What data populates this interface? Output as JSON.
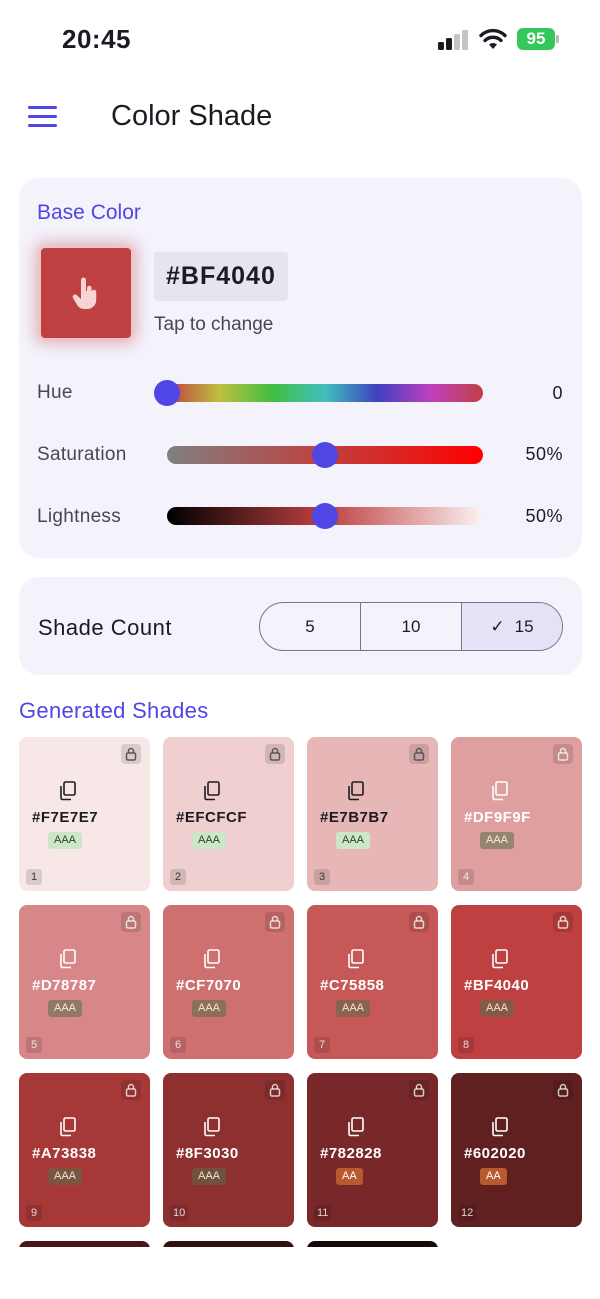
{
  "status_bar": {
    "time": "20:45",
    "battery": "95"
  },
  "app_bar": {
    "title": "Color Shade",
    "menu_icon": "menu-icon"
  },
  "base_color": {
    "section_title": "Base Color",
    "hex": "#BF4040",
    "hint": "Tap to change",
    "swatch_color": "#BF4040",
    "sliders": [
      {
        "label": "Hue",
        "value": "0",
        "fraction": 0.0
      },
      {
        "label": "Saturation",
        "value": "50%",
        "fraction": 0.5
      },
      {
        "label": "Lightness",
        "value": "50%",
        "fraction": 0.5
      }
    ]
  },
  "shade_count": {
    "label": "Shade Count",
    "options": [
      "5",
      "10",
      "15"
    ],
    "selected": "15"
  },
  "generated_shades": {
    "title": "Generated Shades",
    "shades": [
      {
        "index": "1",
        "hex": "#F7E7E7",
        "badge": "AAA"
      },
      {
        "index": "2",
        "hex": "#EFCFCF",
        "badge": "AAA"
      },
      {
        "index": "3",
        "hex": "#E7B7B7",
        "badge": "AAA"
      },
      {
        "index": "4",
        "hex": "#DF9F9F",
        "badge": "AAA"
      },
      {
        "index": "5",
        "hex": "#D78787",
        "badge": "AAA"
      },
      {
        "index": "6",
        "hex": "#CF7070",
        "badge": "AAA"
      },
      {
        "index": "7",
        "hex": "#C75858",
        "badge": "AAA"
      },
      {
        "index": "8",
        "hex": "#BF4040",
        "badge": "AAA"
      },
      {
        "index": "9",
        "hex": "#A73838",
        "badge": "AAA"
      },
      {
        "index": "10",
        "hex": "#8F3030",
        "badge": "AAA"
      },
      {
        "index": "11",
        "hex": "#782828",
        "badge": "AA"
      },
      {
        "index": "12",
        "hex": "#602020",
        "badge": "AA"
      }
    ],
    "partial_shade_colors": [
      "#481818",
      "#301010",
      "#180808"
    ]
  }
}
